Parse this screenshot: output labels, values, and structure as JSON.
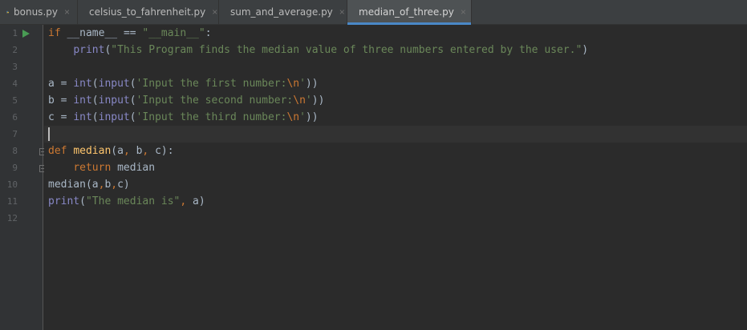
{
  "tabs": [
    {
      "label": "bonus.py",
      "active": false
    },
    {
      "label": "celsius_to_fahrenheit.py",
      "active": false
    },
    {
      "label": "sum_and_average.py",
      "active": false
    },
    {
      "label": "median_of_three.py",
      "active": true
    }
  ],
  "close_glyph": "×",
  "line_numbers": [
    "1",
    "2",
    "3",
    "4",
    "5",
    "6",
    "7",
    "8",
    "9",
    "10",
    "11",
    "12"
  ],
  "code": {
    "l1": {
      "kw_if": "if",
      "t1": " __name__ ",
      "op": "==",
      "t2": " ",
      "s1": "\"__main__\"",
      "t3": ":"
    },
    "l2": {
      "indent": "    ",
      "fn": "print",
      "t1": "(",
      "s1": "\"This Program finds the median value of three numbers entered by the user.\"",
      "t2": ")"
    },
    "l4": {
      "t1": "a = ",
      "b1": "int",
      "t2": "(",
      "b2": "input",
      "t3": "(",
      "s1": "'Input the first number:",
      "e1": "\\n",
      "s2": "'",
      "t4": "))"
    },
    "l5": {
      "t1": "b = ",
      "b1": "int",
      "t2": "(",
      "b2": "input",
      "t3": "(",
      "s1": "'Input the second number:",
      "e1": "\\n",
      "s2": "'",
      "t4": "))"
    },
    "l6": {
      "t1": "c = ",
      "b1": "int",
      "t2": "(",
      "b2": "input",
      "t3": "(",
      "s1": "'Input the third number:",
      "e1": "\\n",
      "s2": "'",
      "t4": "))"
    },
    "l8": {
      "kw": "def",
      "t1": " ",
      "fn": "median",
      "t2": "(a",
      "c1": ",",
      "t3": " b",
      "c2": ",",
      "t4": " c):"
    },
    "l9": {
      "indent": "    ",
      "kw": "return",
      "t1": " median"
    },
    "l10": {
      "t1": "median(a",
      "c1": ",",
      "t2": "b",
      "c2": ",",
      "t3": "c)"
    },
    "l11": {
      "fn": "print",
      "t1": "(",
      "s1": "\"The median is\"",
      "c1": ",",
      "t2": " a)"
    }
  },
  "colors": {
    "keyword": "#cc7832",
    "string": "#6a8759",
    "builtin": "#8888c6",
    "function": "#ffc66d",
    "accent": "#4a88c7",
    "run": "#499c54"
  }
}
